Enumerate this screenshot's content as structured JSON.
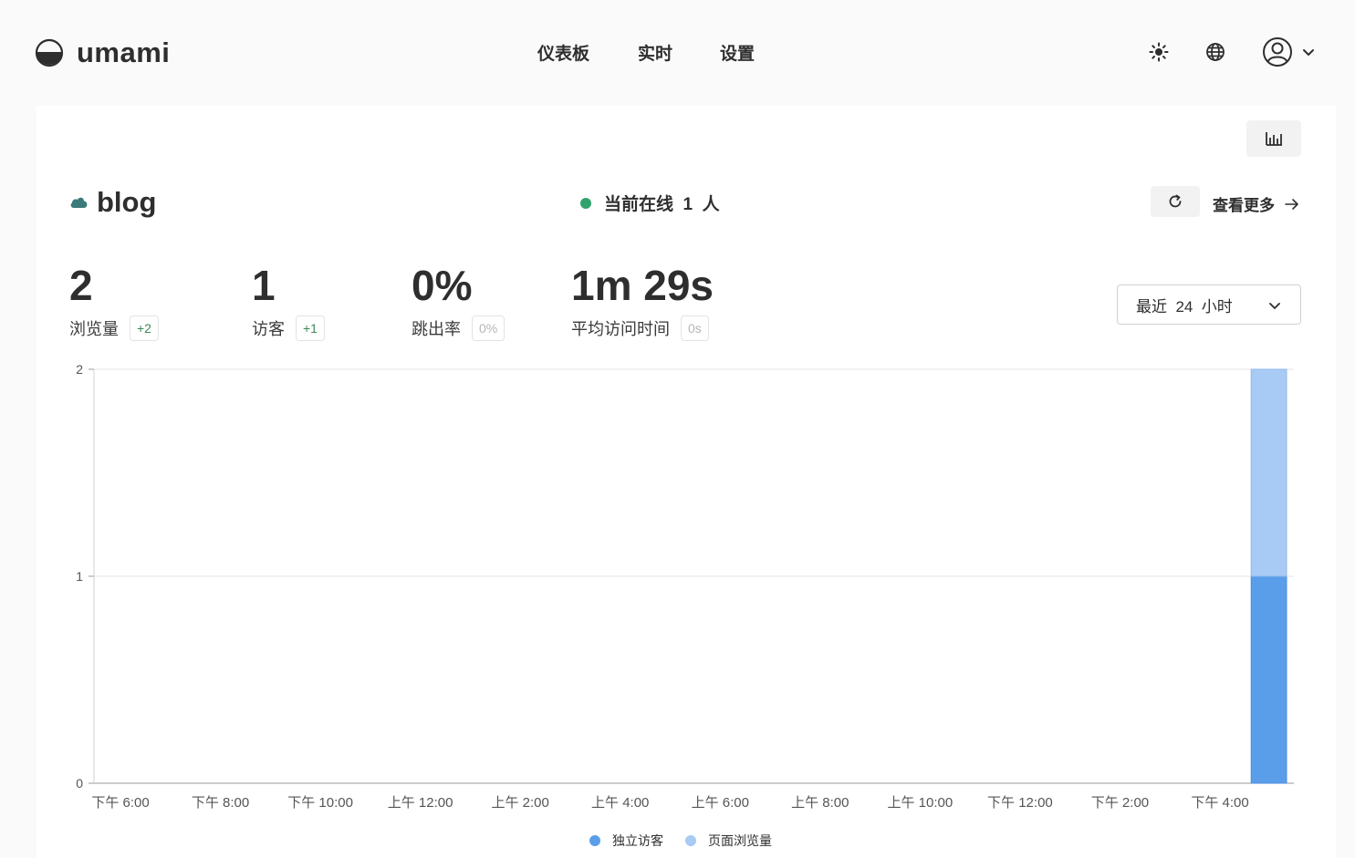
{
  "app": {
    "brand": "umami",
    "nav": [
      "仪表板",
      "实时",
      "设置"
    ]
  },
  "site": {
    "name": "blog",
    "online_text": "当前在线  1  人",
    "view_more": "查看更多"
  },
  "metrics": [
    {
      "value": "2",
      "label": "浏览量",
      "change": "+2"
    },
    {
      "value": "1",
      "label": "访客",
      "change": "+1"
    },
    {
      "value": "0%",
      "label": "跳出率",
      "change": "0%"
    },
    {
      "value": "1m 29s",
      "label": "平均访问时间",
      "change": "0s"
    }
  ],
  "date_range": "最近  24  小时",
  "icons": {
    "logo": "umami-logo-icon",
    "theme": "sun-icon",
    "language": "globe-icon",
    "profile": "user-icon",
    "chart_toggle": "bar-chart-icon",
    "site": "cloud-icon",
    "refresh": "refresh-icon",
    "arrow": "arrow-right-icon"
  },
  "colors": {
    "online_dot": "#2fa36b",
    "visitors": "#5a9ee9",
    "pageviews": "#a8cbf5",
    "positive_change": "#3e8a55"
  },
  "chart_data": {
    "type": "bar",
    "stacked": true,
    "x_tick_labels": [
      "下午 6:00",
      "下午 8:00",
      "下午 10:00",
      "上午 12:00",
      "上午 2:00",
      "上午 4:00",
      "上午 6:00",
      "上午 8:00",
      "上午 10:00",
      "下午 12:00",
      "下午 2:00",
      "下午 4:00"
    ],
    "bins": 24,
    "ylim": [
      0,
      2
    ],
    "yticks": [
      0,
      1,
      2
    ],
    "grid": true,
    "legend_position": "bottom",
    "series": [
      {
        "name": "独立访客",
        "color": "#5a9ee9",
        "values": [
          0,
          0,
          0,
          0,
          0,
          0,
          0,
          0,
          0,
          0,
          0,
          0,
          0,
          0,
          0,
          0,
          0,
          0,
          0,
          0,
          0,
          0,
          0,
          1
        ]
      },
      {
        "name": "页面浏览量",
        "color": "#a8cbf5",
        "values": [
          0,
          0,
          0,
          0,
          0,
          0,
          0,
          0,
          0,
          0,
          0,
          0,
          0,
          0,
          0,
          0,
          0,
          0,
          0,
          0,
          0,
          0,
          0,
          1
        ]
      }
    ]
  }
}
